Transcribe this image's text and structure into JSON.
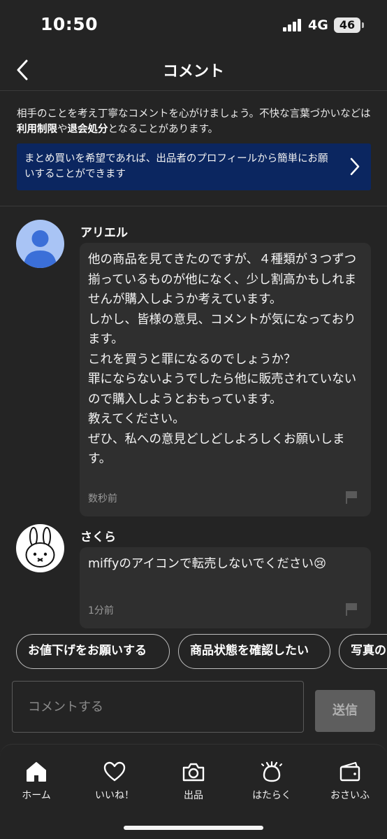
{
  "status_bar": {
    "time": "10:50",
    "network": "4G",
    "battery": "46"
  },
  "header": {
    "title": "コメント"
  },
  "notice": {
    "line_prefix": "相手のことを考え丁寧なコメントを心がけましょう。不快な言葉づかいなどは",
    "bold1": "利用制限",
    "mid": "や",
    "bold2": "退会処分",
    "suffix": "となることがあります。"
  },
  "banner": {
    "text": "まとめ買いを希望であれば、出品者のプロフィールから簡単にお願いすることができます"
  },
  "comments": [
    {
      "name": "アリエル",
      "text": "他の商品を見てきたのですが、４種類が３つずつ揃っているものが他になく、少し割高かもしれませんが購入しようか考えています。\nしかし、皆様の意見、コメントが気になっております。\nこれを買うと罪になるのでしょうか？\n罪にならないようでしたら他に販売されていないので購入しようとおもっています。\n教えてください。\nぜひ、私への意見どしどしよろしくお願いします。",
      "time": "数秒前"
    },
    {
      "name": "さくら",
      "text": "miffyのアイコンで転売しないでください😢",
      "time": "1分前"
    }
  ],
  "chips": [
    "お値下げをお願いする",
    "商品状態を確認したい",
    "写真の"
  ],
  "input": {
    "placeholder": "コメントする",
    "value": ""
  },
  "send_label": "送信",
  "tabs": [
    {
      "label": "ホーム",
      "icon": "home-icon"
    },
    {
      "label": "いいね！",
      "icon": "heart-icon"
    },
    {
      "label": "出品",
      "icon": "camera-icon"
    },
    {
      "label": "はたらく",
      "icon": "work-icon"
    },
    {
      "label": "おさいふ",
      "icon": "wallet-icon"
    }
  ],
  "colors": {
    "background": "#242424",
    "banner": "#0b2660",
    "bubble": "#2f2f2f"
  }
}
